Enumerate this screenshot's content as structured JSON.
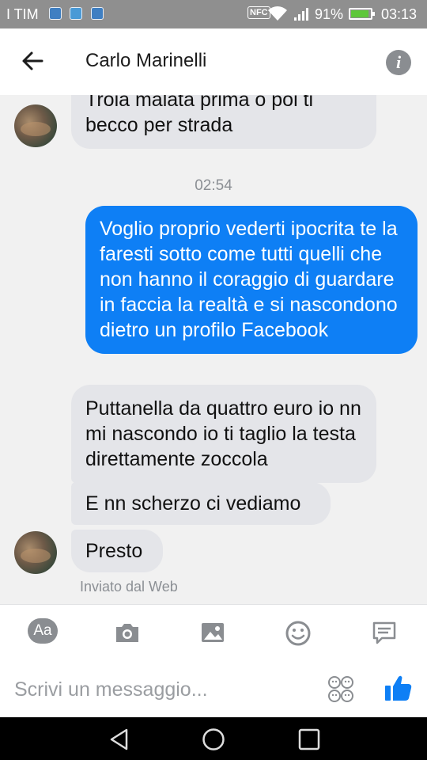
{
  "status_bar": {
    "carrier": "I TIM",
    "nfc": "NFC",
    "battery_percent": "91%",
    "battery_level": 0.91,
    "time": "03:13",
    "icons": [
      "notification-app-icon",
      "notification-app-icon",
      "notification-image-icon",
      "nfc-icon",
      "wifi-icon",
      "signal-icon",
      "battery-charging-icon"
    ]
  },
  "header": {
    "contact_name": "Carlo Marinelli",
    "icons": [
      "back-arrow-icon",
      "info-icon"
    ]
  },
  "messages": [
    {
      "from": "contact",
      "text": "Troia malata prima o poi ti becco per strada"
    },
    {
      "type": "timestamp",
      "text": "02:54"
    },
    {
      "from": "me",
      "text": "Voglio proprio vederti ipocrita te la faresti sotto come tutti quelli che non hanno il coraggio di guardare in faccia la realtà e si nascondono dietro un profilo Facebook"
    },
    {
      "from": "contact",
      "text": "Puttanella da quattro euro io nn mi nascondo io ti taglio la testa direttamente zoccola"
    },
    {
      "from": "contact",
      "text": "E nn scherzo ci vediamo"
    },
    {
      "from": "contact",
      "text": "Presto"
    }
  ],
  "sent_via": "Inviato dal Web",
  "toolbar": {
    "aa_label": "Aa",
    "icons": [
      "text-format-icon",
      "camera-icon",
      "gallery-icon",
      "emoji-icon",
      "quick-reply-icon"
    ]
  },
  "composer": {
    "placeholder": "Scrivi un messaggio...",
    "value": "",
    "icons": [
      "sticker-icon",
      "like-icon"
    ]
  },
  "colors": {
    "status_bar_bg": "#8f8f8f",
    "outgoing_bubble": "#0e7ff5",
    "incoming_bubble": "#e4e5e9",
    "chat_bg": "#f1f1f1",
    "accent_blue": "#0e7ff5",
    "icon_gray": "#8a8d91"
  },
  "navbar": {
    "icons": [
      "nav-back-icon",
      "nav-home-icon",
      "nav-recents-icon"
    ]
  }
}
